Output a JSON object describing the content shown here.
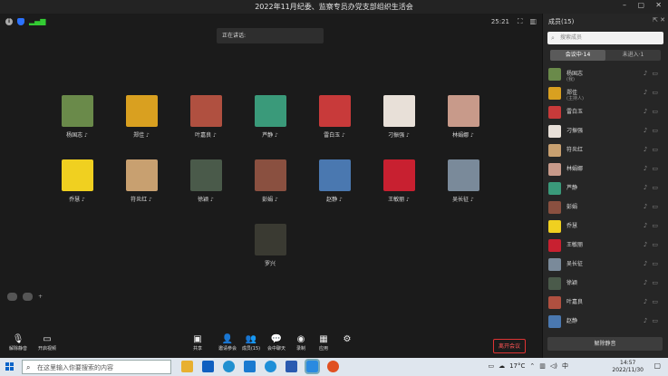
{
  "window": {
    "title": "2022年11月纪委、监察专员办党支部组织生活会"
  },
  "status": {
    "timer": "25:21",
    "speaking_label": "正在讲话:"
  },
  "participants_grid": [
    {
      "name": "杨国志",
      "color": "#6a8a4a"
    },
    {
      "name": "郑佳",
      "color": "#d9a020"
    },
    {
      "name": "叶嘉良",
      "color": "#b05040"
    },
    {
      "name": "芦静",
      "color": "#3a9a7a"
    },
    {
      "name": "雷白玉",
      "color": "#c83a3a"
    },
    {
      "name": "刁振强",
      "color": "#e8e0d8"
    },
    {
      "name": "林娟娜",
      "color": "#c89a8a"
    },
    {
      "name": "乔慧",
      "color": "#f0d020"
    },
    {
      "name": "符炎红",
      "color": "#c8a070"
    },
    {
      "name": "徐颖",
      "color": "#4a5a4a"
    },
    {
      "name": "彭娟",
      "color": "#8a5040"
    },
    {
      "name": "赵静",
      "color": "#4a78b0"
    },
    {
      "name": "王敏丽",
      "color": "#c82030"
    },
    {
      "name": "吴长征",
      "color": "#7a8a9a"
    },
    {
      "name": "罗兴",
      "color": "#3a3a32"
    }
  ],
  "toolbar": {
    "unmute": "解除静音",
    "start_video": "开启视频",
    "share": "共享",
    "invite": "邀请参会",
    "members": "成员(15)",
    "chat": "会中聊天",
    "record": "录制",
    "apps": "应用",
    "leave": "离开会议"
  },
  "sidebar": {
    "title": "成员(15)",
    "search_placeholder": "搜索成员",
    "tab_in_meeting": "会议中·14",
    "tab_not_joined": "未进入·1",
    "unmute_all": "解除静音",
    "members": [
      {
        "name": "杨国志",
        "sub": "(我)",
        "color": "#6a8a4a"
      },
      {
        "name": "郑佳",
        "sub": "(主持人)",
        "color": "#d9a020"
      },
      {
        "name": "雷白玉",
        "sub": "",
        "color": "#c83a3a"
      },
      {
        "name": "刁振强",
        "sub": "",
        "color": "#e8e0d8"
      },
      {
        "name": "符炎红",
        "sub": "",
        "color": "#c8a070"
      },
      {
        "name": "林娟娜",
        "sub": "",
        "color": "#c89a8a"
      },
      {
        "name": "芦静",
        "sub": "",
        "color": "#3a9a7a"
      },
      {
        "name": "彭娟",
        "sub": "",
        "color": "#8a5040"
      },
      {
        "name": "乔慧",
        "sub": "",
        "color": "#f0d020"
      },
      {
        "name": "王敏丽",
        "sub": "",
        "color": "#c82030"
      },
      {
        "name": "吴长征",
        "sub": "",
        "color": "#7a8a9a"
      },
      {
        "name": "徐颖",
        "sub": "",
        "color": "#4a5a4a"
      },
      {
        "name": "叶嘉良",
        "sub": "",
        "color": "#b05040"
      },
      {
        "name": "赵静",
        "sub": "",
        "color": "#4a78b0"
      }
    ]
  },
  "taskbar": {
    "search_placeholder": "在这里输入你要搜索的内容",
    "temperature": "17°C",
    "ime": "中",
    "time": "14:57",
    "date": "2022/11/30"
  }
}
